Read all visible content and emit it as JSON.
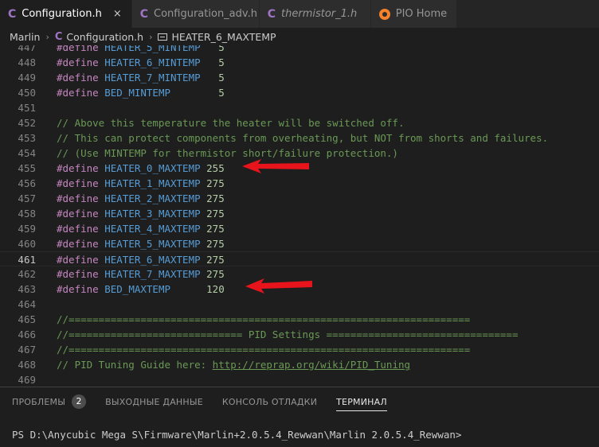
{
  "tabs": [
    {
      "label": "Configuration.h",
      "icon": "c-file-icon",
      "active": true,
      "italic": false
    },
    {
      "label": "Configuration_adv.h",
      "icon": "c-file-icon",
      "active": false,
      "italic": false
    },
    {
      "label": "thermistor_1.h",
      "icon": "c-file-icon",
      "active": false,
      "italic": true
    },
    {
      "label": "PIO Home",
      "icon": "platformio-icon",
      "active": false,
      "italic": false
    }
  ],
  "tab_icon_letter": "C",
  "tab_close_glyph": "×",
  "breadcrumb": {
    "folder": "Marlin",
    "file": "Configuration.h",
    "symbol": "HEATER_6_MAXTEMP",
    "separator": "›"
  },
  "editor": {
    "current_line": "461",
    "lines": [
      {
        "n": "447",
        "tokens": [
          [
            "kw",
            "#define"
          ],
          [
            "mac",
            " HEATER_5_MINTEMP"
          ],
          [
            "num",
            "   5"
          ]
        ]
      },
      {
        "n": "448",
        "tokens": [
          [
            "kw",
            "#define"
          ],
          [
            "mac",
            " HEATER_6_MINTEMP"
          ],
          [
            "num",
            "   5"
          ]
        ]
      },
      {
        "n": "449",
        "tokens": [
          [
            "kw",
            "#define"
          ],
          [
            "mac",
            " HEATER_7_MINTEMP"
          ],
          [
            "num",
            "   5"
          ]
        ]
      },
      {
        "n": "450",
        "tokens": [
          [
            "kw",
            "#define"
          ],
          [
            "mac",
            " BED_MINTEMP"
          ],
          [
            "num",
            "        5"
          ]
        ]
      },
      {
        "n": "451",
        "tokens": []
      },
      {
        "n": "452",
        "tokens": [
          [
            "cmt",
            "// Above this temperature the heater will be switched off."
          ]
        ]
      },
      {
        "n": "453",
        "tokens": [
          [
            "cmt",
            "// This can protect components from overheating, but NOT from shorts and failures."
          ]
        ]
      },
      {
        "n": "454",
        "tokens": [
          [
            "cmt",
            "// (Use MINTEMP for thermistor short/failure protection.)"
          ]
        ]
      },
      {
        "n": "455",
        "tokens": [
          [
            "kw",
            "#define"
          ],
          [
            "mac",
            " HEATER_0_MAXTEMP"
          ],
          [
            "num",
            " 255"
          ]
        ]
      },
      {
        "n": "456",
        "tokens": [
          [
            "kw",
            "#define"
          ],
          [
            "mac",
            " HEATER_1_MAXTEMP"
          ],
          [
            "num",
            " 275"
          ]
        ]
      },
      {
        "n": "457",
        "tokens": [
          [
            "kw",
            "#define"
          ],
          [
            "mac",
            " HEATER_2_MAXTEMP"
          ],
          [
            "num",
            " 275"
          ]
        ]
      },
      {
        "n": "458",
        "tokens": [
          [
            "kw",
            "#define"
          ],
          [
            "mac",
            " HEATER_3_MAXTEMP"
          ],
          [
            "num",
            " 275"
          ]
        ]
      },
      {
        "n": "459",
        "tokens": [
          [
            "kw",
            "#define"
          ],
          [
            "mac",
            " HEATER_4_MAXTEMP"
          ],
          [
            "num",
            " 275"
          ]
        ]
      },
      {
        "n": "460",
        "tokens": [
          [
            "kw",
            "#define"
          ],
          [
            "mac",
            " HEATER_5_MAXTEMP"
          ],
          [
            "num",
            " 275"
          ]
        ]
      },
      {
        "n": "461",
        "tokens": [
          [
            "kw",
            "#define"
          ],
          [
            "mac",
            " HEATER_6_MAXTEMP"
          ],
          [
            "num",
            " 275"
          ]
        ]
      },
      {
        "n": "462",
        "tokens": [
          [
            "kw",
            "#define"
          ],
          [
            "mac",
            " HEATER_7_MAXTEMP"
          ],
          [
            "num",
            " 275"
          ]
        ]
      },
      {
        "n": "463",
        "tokens": [
          [
            "kw",
            "#define"
          ],
          [
            "mac",
            " BED_MAXTEMP"
          ],
          [
            "num",
            "      120"
          ]
        ]
      },
      {
        "n": "464",
        "tokens": []
      },
      {
        "n": "465",
        "tokens": [
          [
            "cmt",
            "//==================================================================="
          ]
        ]
      },
      {
        "n": "466",
        "tokens": [
          [
            "cmt",
            "//============================= PID Settings ================================"
          ]
        ]
      },
      {
        "n": "467",
        "tokens": [
          [
            "cmt",
            "//==================================================================="
          ]
        ]
      },
      {
        "n": "468",
        "tokens": [
          [
            "cmt",
            "// PID Tuning Guide here: "
          ],
          [
            "url",
            "http://reprap.org/wiki/PID_Tuning"
          ]
        ]
      },
      {
        "n": "469",
        "tokens": []
      }
    ]
  },
  "annotations": {
    "arrow_color": "#e8141c",
    "icon": "red-arrow-icon"
  },
  "panel": {
    "tabs": [
      {
        "label": "ПРОБЛЕМЫ",
        "badge": "2",
        "active": false
      },
      {
        "label": "ВЫХОДНЫЕ ДАННЫЕ",
        "badge": "",
        "active": false
      },
      {
        "label": "КОНСОЛЬ ОТЛАДКИ",
        "badge": "",
        "active": false
      },
      {
        "label": "ТЕРМИНАЛ",
        "badge": "",
        "active": true
      }
    ],
    "terminal_prompt": "PS D:\\Anycubic Mega S\\Firmware\\Marlin+2.0.5.4_Rewwan\\Marlin 2.0.5.4_Rewwan>"
  },
  "colors": {
    "keyword": "#c586c0",
    "macro": "#569cd6",
    "number": "#b5cea8",
    "comment": "#6a9955"
  }
}
